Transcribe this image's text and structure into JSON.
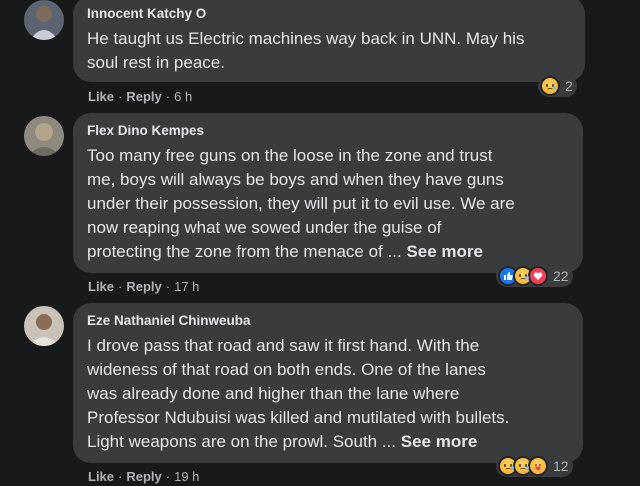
{
  "comments": [
    {
      "author": "Innocent Katchy O",
      "lines": [
        "He taught us Electric machines way back in UNN. May his",
        "soul rest in peace."
      ],
      "see_more": "",
      "actions": {
        "like": "Like",
        "reply": "Reply",
        "time": "6 h"
      },
      "reactions": {
        "icons": [
          "sad-icon"
        ],
        "count": "2"
      }
    },
    {
      "author": "Flex Dino Kempes",
      "lines": [
        "Too many free guns on the loose in the zone and trust",
        "me, boys will always be boys and when they have guns",
        "under their possession, they will put it to evil use. We are",
        "now reaping what we sowed under the guise of",
        "protecting the zone from the menace of ..."
      ],
      "see_more": "See more",
      "actions": {
        "like": "Like",
        "reply": "Reply",
        "time": "17 h"
      },
      "reactions": {
        "icons": [
          "like-icon",
          "sad-icon",
          "love-icon"
        ],
        "count": "22"
      }
    },
    {
      "author": "Eze Nathaniel Chinweuba",
      "lines": [
        "I drove pass that road and saw it first hand. With the",
        "wideness of that road on both ends. One of the lanes",
        "was already done and higher than the lane where",
        "Professor Ndubuisi was killed and mutilated with bullets.",
        "Light weapons are on the prowl. South ..."
      ],
      "see_more": "See more",
      "actions": {
        "like": "Like",
        "reply": "Reply",
        "time": "19 h"
      },
      "reactions": {
        "icons": [
          "sad-icon",
          "sad-icon",
          "care-icon"
        ],
        "count": "12"
      }
    }
  ],
  "colors": {
    "background": "#18191a",
    "bubble": "#3a3b3c",
    "text": "#e4e6eb",
    "muted": "#b0b3b8",
    "like": "#1877f2",
    "love": "#f33e58"
  }
}
